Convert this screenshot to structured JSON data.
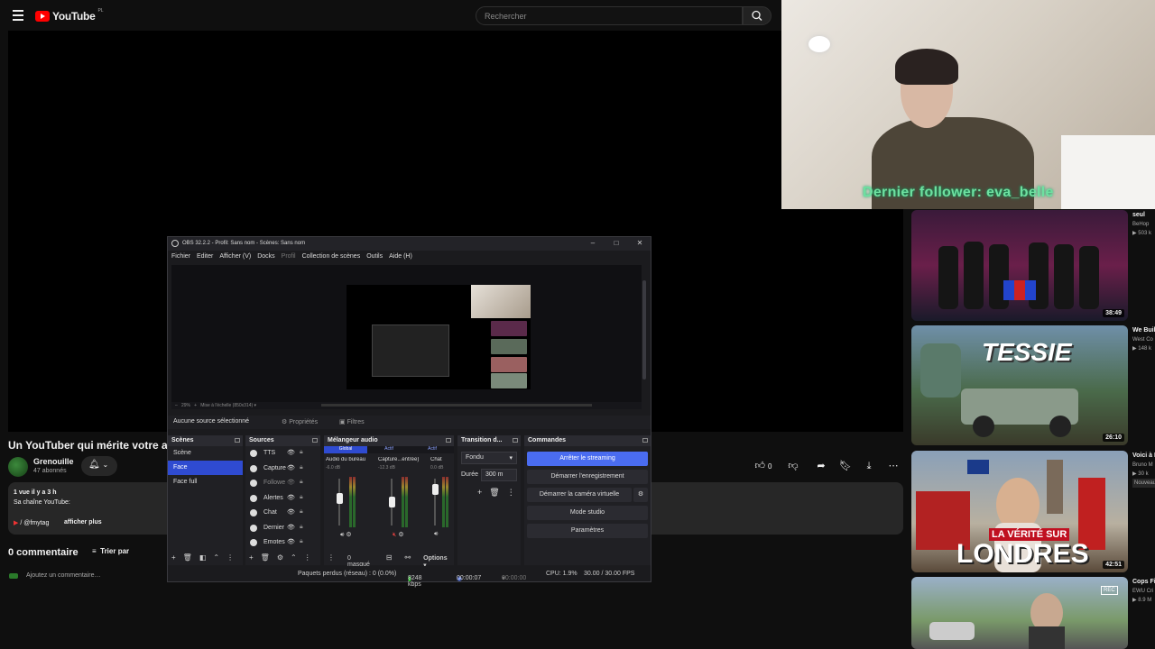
{
  "youtube": {
    "logo": "YouTube",
    "region": "PL",
    "search_placeholder": "Rechercher",
    "video_title": "Un YouTuber qui mérite votre attention",
    "channel": {
      "name": "Grenouille",
      "subscribers": "47 abonnés"
    },
    "like_count": "0",
    "description": {
      "meta": "1 vue  il y a 3 h",
      "line": "Sa chaîne YouTube:",
      "link": "/ @fmytag",
      "more": "afficher plus"
    },
    "comments_title": "0 commentaire",
    "sort_label": "Trier par",
    "add_comment": "Ajoutez un commentaire…"
  },
  "webcam": {
    "overlay_text": "Dernier follower: eva_belle"
  },
  "recommendations": [
    {
      "duration": "38:49",
      "title": "seul",
      "channel": "BeHop",
      "views": "503 k"
    },
    {
      "duration": "26:10",
      "title": "We Buil Call of",
      "channel": "West Co",
      "views": "148 k",
      "thumb_text": "TESSIE"
    },
    {
      "duration": "42:51",
      "title": "Voici à LOND",
      "channel": "Bruno M",
      "views": "30 k",
      "badge": "Nouveau",
      "thumb_text_1": "LA VÉRITÉ SUR",
      "thumb_text_2": "LONDRES"
    },
    {
      "duration": "",
      "title": "Cops Fi in Mom",
      "channel": "EWU Cri",
      "views": "8.9 M",
      "thumb_text": "REC"
    }
  ],
  "obs": {
    "title": "OBS 32.2.2 - Profil: Sans nom - Scènes: Sans nom",
    "menu": [
      "Fichier",
      "Editer",
      "Afficher (V)",
      "Docks",
      "Profil",
      "Collection de scènes",
      "Outils",
      "Aide (H)"
    ],
    "preview_zoom": "29%",
    "preview_scale": "Mise à l'échelle (850x314)",
    "no_source": "Aucune source sélectionné",
    "properties": "Propriétés",
    "filters": "Filtres",
    "scenes_title": "Scènes",
    "scenes": [
      "Scène",
      "Face",
      "Face full"
    ],
    "selected_scene": "Face",
    "sources_title": "Sources",
    "sources": [
      "TTS",
      "Capture",
      "Followe",
      "Alertes",
      "Chat",
      "Dernier",
      "Emotes"
    ],
    "mixer_title": "Mélangeur audio",
    "mixer_tabs": [
      "Global",
      "Actif",
      "Actif"
    ],
    "channels": [
      {
        "name": "Audio du bureau",
        "db": "-6.0 dB"
      },
      {
        "name": "Capture...entrée)",
        "db": "-12.3 dB"
      },
      {
        "name": "Chat",
        "db": "0.0 dB"
      }
    ],
    "hidden_count": "0 masqué",
    "options": "Options",
    "transition_title": "Transition d...",
    "transition": "Fondu",
    "duration_label": "Durée",
    "duration_value": "300 m",
    "commands_title": "Commandes",
    "commands": [
      "Arrêter le streaming",
      "Démarrer l'enregistrement",
      "Démarrer la caméra virtuelle",
      "Mode studio",
      "Paramètres"
    ],
    "status": {
      "dropped": "Paquets perdus (réseau) : 0 (0.0%)",
      "bitrate": "8248 kbps",
      "stream_time": "00:00:07",
      "rec_time": "00:00:00",
      "cpu": "CPU: 1.9%",
      "fps": "30.00 / 30.00 FPS"
    }
  }
}
